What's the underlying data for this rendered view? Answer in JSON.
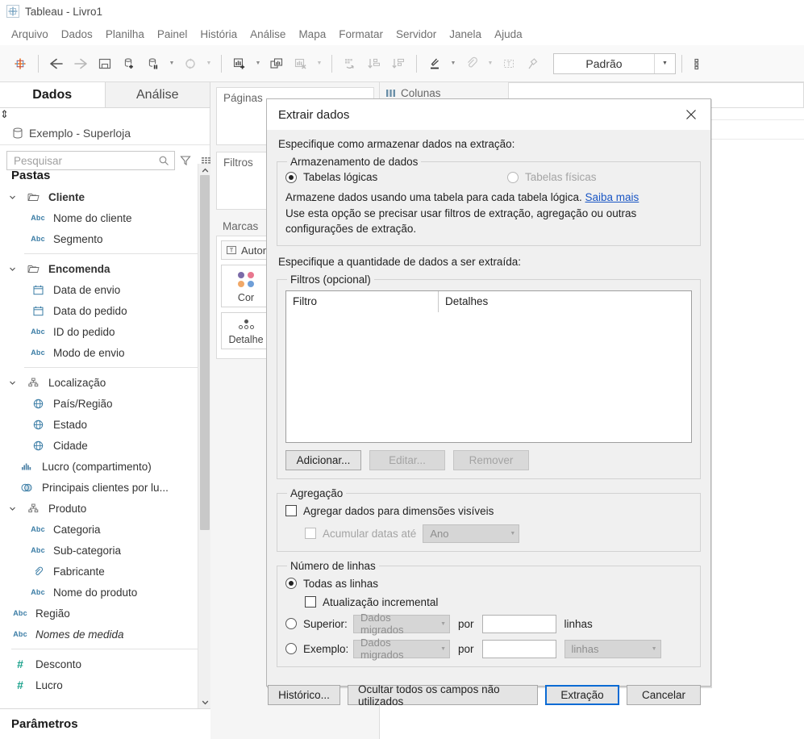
{
  "window": {
    "title": "Tableau - Livro1",
    "logo_icon": "tableau-logo-icon"
  },
  "menubar": {
    "items": [
      {
        "label": "Arquivo"
      },
      {
        "label": "Dados"
      },
      {
        "label": "Planilha"
      },
      {
        "label": "Painel"
      },
      {
        "label": "História"
      },
      {
        "label": "Análise"
      },
      {
        "label": "Mapa"
      },
      {
        "label": "Formatar"
      },
      {
        "label": "Servidor"
      },
      {
        "label": "Janela"
      },
      {
        "label": "Ajuda"
      }
    ]
  },
  "toolbar": {
    "buttons": [
      {
        "name": "tableau-home-icon"
      },
      {
        "name": "back-arrow-icon"
      },
      {
        "name": "forward-arrow-icon"
      },
      {
        "name": "save-icon"
      },
      {
        "name": "new-data-source-icon"
      },
      {
        "name": "pause-data-source-icon"
      },
      {
        "name": "refresh-data-source-icon"
      },
      {
        "name": "new-worksheet-icon"
      },
      {
        "name": "duplicate-sheet-icon"
      },
      {
        "name": "clear-sheet-icon"
      },
      {
        "name": "swap-rows-columns-icon"
      },
      {
        "name": "sort-ascending-icon"
      },
      {
        "name": "sort-descending-icon"
      },
      {
        "name": "highlight-icon"
      },
      {
        "name": "group-members-icon"
      },
      {
        "name": "show-mark-labels-icon"
      },
      {
        "name": "fix-axes-icon"
      },
      {
        "name": "presentation-mode-icon"
      }
    ],
    "fit_combo": {
      "value": "Padrão",
      "arrow_icon": "chevron-down-icon"
    }
  },
  "data_pane": {
    "tabs": [
      {
        "label": "Dados",
        "active": true
      },
      {
        "label": "Análise",
        "active": false
      }
    ],
    "sort_icon": "sort-updown-icon",
    "data_source": {
      "icon": "database-icon",
      "name": "Exemplo - Superloja"
    },
    "search": {
      "placeholder": "Pesquisar",
      "search_icon": "search-icon",
      "filter_icon": "filter-funnel-icon",
      "grid_icon": "grid-view-icon",
      "caret_icon": "chevron-down-icon"
    },
    "sections": [
      {
        "label": "Pastas"
      }
    ],
    "fields": [
      {
        "label": "Cliente",
        "icon": "folder-icon",
        "kind": "folder",
        "indent": 0,
        "expander": "chevron-down-icon",
        "bold": true
      },
      {
        "label": "Nome do cliente",
        "icon": "abc-icon",
        "kind": "string",
        "indent": 1
      },
      {
        "label": "Segmento",
        "icon": "abc-icon",
        "kind": "string",
        "indent": 1
      },
      {
        "divider": true
      },
      {
        "label": "Encomenda",
        "icon": "folder-icon",
        "kind": "folder",
        "indent": 0,
        "expander": "chevron-down-icon",
        "bold": true
      },
      {
        "label": "Data de envio",
        "icon": "calendar-icon",
        "kind": "date",
        "indent": 1
      },
      {
        "label": "Data do pedido",
        "icon": "calendar-icon",
        "kind": "date",
        "indent": 1
      },
      {
        "label": "ID do pedido",
        "icon": "abc-icon",
        "kind": "string",
        "indent": 1
      },
      {
        "label": "Modo de envio",
        "icon": "abc-icon",
        "kind": "string",
        "indent": 1
      },
      {
        "divider": true
      },
      {
        "label": "Localização",
        "icon": "hierarchy-icon",
        "kind": "hierarchy",
        "indent": 0,
        "expander": "chevron-down-icon"
      },
      {
        "label": "País/Região",
        "icon": "globe-icon",
        "kind": "geo",
        "indent": 1
      },
      {
        "label": "Estado",
        "icon": "globe-icon",
        "kind": "geo",
        "indent": 1
      },
      {
        "label": "Cidade",
        "icon": "globe-icon",
        "kind": "geo",
        "indent": 1
      },
      {
        "label": "Lucro (compartimento)",
        "icon": "bins-icon",
        "kind": "bin",
        "indent": 0
      },
      {
        "label": "Principais clientes por lu...",
        "icon": "set-icon",
        "kind": "set",
        "indent": 0
      },
      {
        "label": "Produto",
        "icon": "hierarchy-icon",
        "kind": "hierarchy",
        "indent": 0,
        "expander": "chevron-down-icon"
      },
      {
        "label": "Categoria",
        "icon": "abc-icon",
        "kind": "string",
        "indent": 1
      },
      {
        "label": "Sub-categoria",
        "icon": "abc-icon",
        "kind": "string",
        "indent": 1
      },
      {
        "label": "Fabricante",
        "icon": "paperclip-icon",
        "kind": "calculated",
        "indent": 1
      },
      {
        "label": "Nome do produto",
        "icon": "abc-icon",
        "kind": "string",
        "indent": 1
      },
      {
        "label": "Região",
        "icon": "abc-icon",
        "kind": "string",
        "indent": 0
      },
      {
        "label": "Nomes de medida",
        "icon": "abc-icon",
        "kind": "string",
        "indent": 0,
        "italic": true
      },
      {
        "divider": true
      },
      {
        "label": "Desconto",
        "icon": "hash-icon",
        "kind": "measure",
        "indent": 0
      },
      {
        "label": "Lucro",
        "icon": "hash-icon",
        "kind": "measure",
        "indent": 0
      }
    ],
    "parameters_header": "Parâmetros",
    "scrollbar": {
      "up_icon": "chevron-up-icon",
      "down_icon": "chevron-down-icon"
    }
  },
  "shelves": {
    "pages_label": "Páginas",
    "filters_label": "Filtros",
    "marks_label": "Marcas",
    "mark_type": {
      "label": "Automático",
      "icon": "text-mark-icon",
      "caret_icon": "chevron-down-icon"
    },
    "cards": [
      {
        "label": "Cor",
        "icon": "color-dots-icon",
        "colors": [
          "#7b6ba8",
          "#e8778f",
          "#f0a868",
          "#6f9fd8"
        ]
      },
      {
        "label": "Detalhe",
        "icon": "detail-dots-icon"
      }
    ],
    "columns_label": "Colunas",
    "columns_icon": "columns-icon"
  },
  "dialog": {
    "title": "Extrair dados",
    "close_icon": "close-icon",
    "storage_note": "Especifique como armazenar dados na extração:",
    "storage_group": {
      "legend": "Armazenamento de dados",
      "options": [
        {
          "label": "Tabelas lógicas",
          "selected": true,
          "disabled": false
        },
        {
          "label": "Tabelas físicas",
          "selected": false,
          "disabled": true
        }
      ],
      "description_line1": "Armazene dados usando uma tabela para cada tabela lógica.",
      "learn_more": "Saiba mais",
      "description_line2": "Use esta opção se precisar usar filtros de extração, agregação ou outras configurações de extração."
    },
    "amount_note": "Especifique a quantidade de dados a ser extraída:",
    "filters_group": {
      "legend": "Filtros (opcional)",
      "columns": [
        "Filtro",
        "Detalhes"
      ],
      "rows": [],
      "buttons": [
        {
          "label": "Adicionar...",
          "disabled": false
        },
        {
          "label": "Editar...",
          "disabled": true
        },
        {
          "label": "Remover",
          "disabled": true
        }
      ]
    },
    "aggregation_group": {
      "legend": "Agregação",
      "aggregate_checkbox": {
        "label": "Agregar dados para dimensões visíveis",
        "checked": false,
        "disabled": false
      },
      "rollup_checkbox": {
        "label": "Acumular datas até",
        "checked": false,
        "disabled": true
      },
      "rollup_select": {
        "value": "Ano",
        "disabled": true,
        "arrow_icon": "chevron-down-icon"
      }
    },
    "rows_group": {
      "legend": "Número de linhas",
      "all_rows": {
        "label": "Todas as linhas",
        "selected": true
      },
      "incremental_checkbox": {
        "label": "Atualização incremental",
        "checked": false,
        "disabled": false
      },
      "top": {
        "label": "Superior:",
        "selected": false,
        "field_select": {
          "value": "Dados migrados",
          "disabled": true,
          "arrow_icon": "chevron-down-icon"
        },
        "by_label": "por",
        "value_input": "",
        "unit_label": "linhas"
      },
      "sample": {
        "label": "Exemplo:",
        "selected": false,
        "field_select": {
          "value": "Dados migrados",
          "disabled": true,
          "arrow_icon": "chevron-down-icon"
        },
        "by_label": "por",
        "value_input": "",
        "unit_select": {
          "value": "linhas",
          "disabled": true,
          "arrow_icon": "chevron-down-icon"
        }
      }
    },
    "footer_buttons": [
      {
        "label": "Histórico...",
        "primary": false
      },
      {
        "label": "Ocultar todos os campos não utilizados",
        "primary": false
      },
      {
        "label": "Extração",
        "primary": true
      },
      {
        "label": "Cancelar",
        "primary": false
      }
    ]
  },
  "colors": {
    "accent": "#0b6bd4",
    "link": "#1a56c4",
    "dialog_bg": "#f0f0f0",
    "app_bg": "#f5f5f5",
    "measure_green": "#18a08a",
    "dimension_blue": "#3a7ca5"
  }
}
